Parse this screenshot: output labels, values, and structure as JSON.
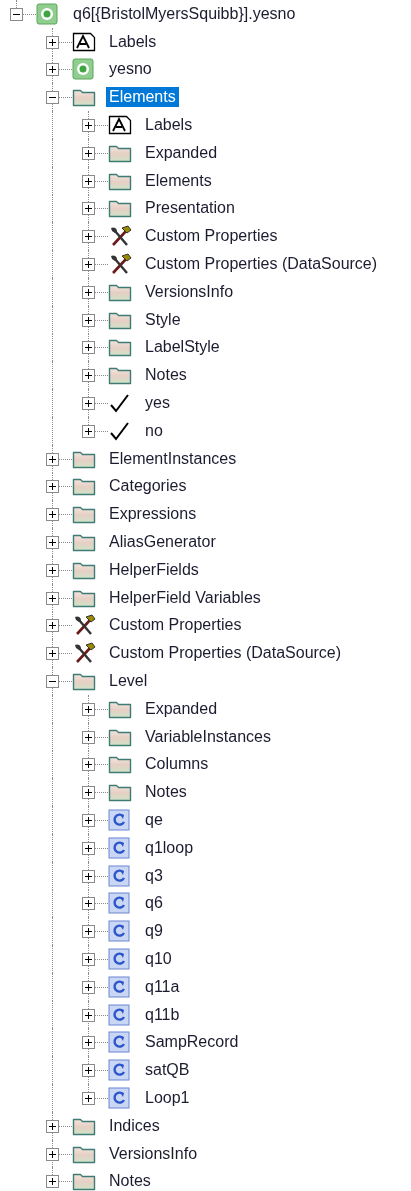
{
  "tree": [
    {
      "label": "q6[{BristolMyersSquibb}].yesno",
      "kind": "variable",
      "expanded": true,
      "selected": false,
      "children": [
        {
          "label": "Labels",
          "kind": "labels",
          "expanded": false,
          "selected": false
        },
        {
          "label": "yesno",
          "kind": "variable",
          "expanded": false,
          "selected": false
        },
        {
          "label": "Elements",
          "kind": "folder",
          "expanded": true,
          "selected": true,
          "children": [
            {
              "label": "Labels",
              "kind": "labels",
              "expanded": false,
              "selected": false
            },
            {
              "label": "Expanded",
              "kind": "folder",
              "expanded": false,
              "selected": false
            },
            {
              "label": "Elements",
              "kind": "folder",
              "expanded": false,
              "selected": false
            },
            {
              "label": "Presentation",
              "kind": "folder",
              "expanded": false,
              "selected": false
            },
            {
              "label": "Custom Properties",
              "kind": "tools",
              "expanded": false,
              "selected": false
            },
            {
              "label": "Custom Properties (DataSource)",
              "kind": "tools",
              "expanded": false,
              "selected": false
            },
            {
              "label": "VersionsInfo",
              "kind": "folder",
              "expanded": false,
              "selected": false
            },
            {
              "label": "Style",
              "kind": "folder",
              "expanded": false,
              "selected": false
            },
            {
              "label": "LabelStyle",
              "kind": "folder",
              "expanded": false,
              "selected": false
            },
            {
              "label": "Notes",
              "kind": "folder",
              "expanded": false,
              "selected": false
            },
            {
              "label": "yes",
              "kind": "check",
              "expanded": false,
              "selected": false
            },
            {
              "label": "no",
              "kind": "check",
              "expanded": false,
              "selected": false
            }
          ]
        },
        {
          "label": "ElementInstances",
          "kind": "folder",
          "expanded": false,
          "selected": false
        },
        {
          "label": "Categories",
          "kind": "folder",
          "expanded": false,
          "selected": false
        },
        {
          "label": "Expressions",
          "kind": "folder",
          "expanded": false,
          "selected": false
        },
        {
          "label": "AliasGenerator",
          "kind": "folder",
          "expanded": false,
          "selected": false
        },
        {
          "label": "HelperFields",
          "kind": "folder",
          "expanded": false,
          "selected": false
        },
        {
          "label": "HelperField Variables",
          "kind": "folder",
          "expanded": false,
          "selected": false
        },
        {
          "label": "Custom Properties",
          "kind": "tools",
          "expanded": false,
          "selected": false
        },
        {
          "label": "Custom Properties (DataSource)",
          "kind": "tools",
          "expanded": false,
          "selected": false
        },
        {
          "label": "Level",
          "kind": "folder",
          "expanded": true,
          "selected": false,
          "children": [
            {
              "label": "Expanded",
              "kind": "folder",
              "expanded": false,
              "selected": false
            },
            {
              "label": "VariableInstances",
              "kind": "folder",
              "expanded": false,
              "selected": false
            },
            {
              "label": "Columns",
              "kind": "folder",
              "expanded": false,
              "selected": false
            },
            {
              "label": "Notes",
              "kind": "folder",
              "expanded": false,
              "selected": false
            },
            {
              "label": "qe",
              "kind": "field",
              "expanded": false,
              "selected": false
            },
            {
              "label": "q1loop",
              "kind": "field",
              "expanded": false,
              "selected": false
            },
            {
              "label": "q3",
              "kind": "field",
              "expanded": false,
              "selected": false
            },
            {
              "label": "q6",
              "kind": "field",
              "expanded": false,
              "selected": false
            },
            {
              "label": "q9",
              "kind": "field",
              "expanded": false,
              "selected": false
            },
            {
              "label": "q10",
              "kind": "field",
              "expanded": false,
              "selected": false
            },
            {
              "label": "q11a",
              "kind": "field",
              "expanded": false,
              "selected": false
            },
            {
              "label": "q11b",
              "kind": "field",
              "expanded": false,
              "selected": false
            },
            {
              "label": "SampRecord",
              "kind": "field",
              "expanded": false,
              "selected": false
            },
            {
              "label": "satQB",
              "kind": "field",
              "expanded": false,
              "selected": false
            },
            {
              "label": "Loop1",
              "kind": "field",
              "expanded": false,
              "selected": false
            }
          ]
        },
        {
          "label": "Indices",
          "kind": "folder",
          "expanded": false,
          "selected": false
        },
        {
          "label": "VersionsInfo",
          "kind": "folder",
          "expanded": false,
          "selected": false
        },
        {
          "label": "Notes",
          "kind": "folder",
          "expanded": false,
          "selected": false
        }
      ]
    }
  ]
}
